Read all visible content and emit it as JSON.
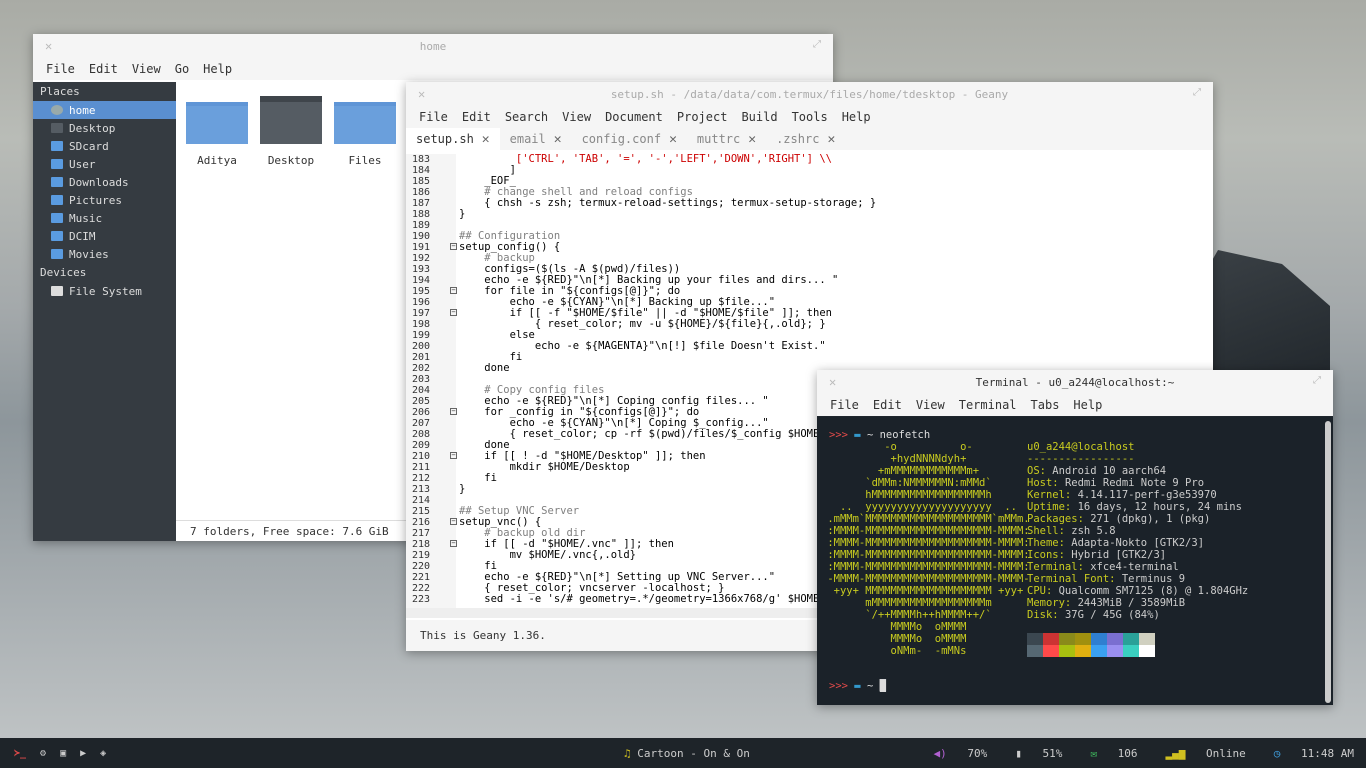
{
  "filemanager": {
    "title": "home",
    "menu": [
      "File",
      "Edit",
      "View",
      "Go",
      "Help"
    ],
    "places_header": "Places",
    "places": [
      "home",
      "Desktop",
      "SDcard",
      "User",
      "Downloads",
      "Pictures",
      "Music",
      "DCIM",
      "Movies"
    ],
    "devices_header": "Devices",
    "devices": [
      "File System"
    ],
    "folders": [
      "Aditya",
      "Desktop",
      "Files"
    ],
    "status": "7 folders, Free space: 7.6 GiB"
  },
  "geany": {
    "title": "setup.sh - /data/data/com.termux/files/home/tdesktop - Geany",
    "menu": [
      "File",
      "Edit",
      "Search",
      "View",
      "Document",
      "Project",
      "Build",
      "Tools",
      "Help"
    ],
    "tabs": [
      "setup.sh",
      "email",
      "config.conf",
      "muttrc",
      ".zshrc"
    ],
    "status": "This is Geany 1.36.",
    "lines": [
      {
        "n": "183",
        "t": "         ['CTRL', 'TAB', '=', '-','LEFT','DOWN','RIGHT'] \\\\"
      },
      {
        "n": "184",
        "t": "        ]"
      },
      {
        "n": "185",
        "t": "    _EOF_"
      },
      {
        "n": "186",
        "t": "    # change shell and reload configs"
      },
      {
        "n": "187",
        "t": "    { chsh -s zsh; termux-reload-settings; termux-setup-storage; }"
      },
      {
        "n": "188",
        "t": "}"
      },
      {
        "n": "189",
        "t": ""
      },
      {
        "n": "190",
        "t": "## Configuration"
      },
      {
        "n": "191",
        "t": "setup_config() {"
      },
      {
        "n": "192",
        "t": "    # backup"
      },
      {
        "n": "193",
        "t": "    configs=($(ls -A $(pwd)/files))"
      },
      {
        "n": "194",
        "t": "    echo -e ${RED}\"\\n[*] Backing up your files and dirs... \""
      },
      {
        "n": "195",
        "t": "    for file in \"${configs[@]}\"; do"
      },
      {
        "n": "196",
        "t": "        echo -e ${CYAN}\"\\n[*] Backing up $file...\""
      },
      {
        "n": "197",
        "t": "        if [[ -f \"$HOME/$file\" || -d \"$HOME/$file\" ]]; then"
      },
      {
        "n": "198",
        "t": "            { reset_color; mv -u ${HOME}/${file}{,.old}; }"
      },
      {
        "n": "199",
        "t": "        else"
      },
      {
        "n": "200",
        "t": "            echo -e ${MAGENTA}\"\\n[!] $file Doesn't Exist.\""
      },
      {
        "n": "201",
        "t": "        fi"
      },
      {
        "n": "202",
        "t": "    done"
      },
      {
        "n": "203",
        "t": ""
      },
      {
        "n": "204",
        "t": "    # Copy config files"
      },
      {
        "n": "205",
        "t": "    echo -e ${RED}\"\\n[*] Coping config files... \""
      },
      {
        "n": "206",
        "t": "    for _config in \"${configs[@]}\"; do"
      },
      {
        "n": "207",
        "t": "        echo -e ${CYAN}\"\\n[*] Coping $_config...\""
      },
      {
        "n": "208",
        "t": "        { reset_color; cp -rf $(pwd)/files/$_config $HOME; }"
      },
      {
        "n": "209",
        "t": "    done"
      },
      {
        "n": "210",
        "t": "    if [[ ! -d \"$HOME/Desktop\" ]]; then"
      },
      {
        "n": "211",
        "t": "        mkdir $HOME/Desktop"
      },
      {
        "n": "212",
        "t": "    fi"
      },
      {
        "n": "213",
        "t": "}"
      },
      {
        "n": "214",
        "t": ""
      },
      {
        "n": "215",
        "t": "## Setup VNC Server"
      },
      {
        "n": "216",
        "t": "setup_vnc() {"
      },
      {
        "n": "217",
        "t": "    # backup old dir"
      },
      {
        "n": "218",
        "t": "    if [[ -d \"$HOME/.vnc\" ]]; then"
      },
      {
        "n": "219",
        "t": "        mv $HOME/.vnc{,.old}"
      },
      {
        "n": "220",
        "t": "    fi"
      },
      {
        "n": "221",
        "t": "    echo -e ${RED}\"\\n[*] Setting up VNC Server...\""
      },
      {
        "n": "222",
        "t": "    { reset_color; vncserver -localhost; }"
      },
      {
        "n": "223",
        "t": "    sed -i -e 's/# geometry=.*/geometry=1366x768/g' $HOME/.vnc"
      }
    ]
  },
  "terminal": {
    "title": "Terminal - u0_a244@localhost:~",
    "menu": [
      "File",
      "Edit",
      "View",
      "Terminal",
      "Tabs",
      "Help"
    ],
    "prompt": ">>> ",
    "cmd": "~ neofetch",
    "prompt2": ">>> ",
    "cwd2": "~ ",
    "logo": [
      "          -o          o-",
      "           +hydNNNNdyh+",
      "         +mMMMMMMMMMMMMm+",
      "       `dMMm:NMMMMMMN:mMMd`",
      "       hMMMMMMMMMMMMMMMMMMh",
      "   ..  yyyyyyyyyyyyyyyyyyyy  ..",
      " .mMMm`MMMMMMMMMMMMMMMMMMMM`mMMm.",
      " :MMMM-MMMMMMMMMMMMMMMMMMMM-MMMM:",
      " :MMMM-MMMMMMMMMMMMMMMMMMMM-MMMM:",
      " :MMMM-MMMMMMMMMMMMMMMMMMMM-MMMM:",
      " :MMMM-MMMMMMMMMMMMMMMMMMMM-MMMM:",
      " -MMMM-MMMMMMMMMMMMMMMMMMMM-MMMM-",
      "  +yy+ MMMMMMMMMMMMMMMMMMMM +yy+",
      "       mMMMMMMMMMMMMMMMMMMm",
      "       `/++MMMMh++hMMMM++/`",
      "           MMMMo  oMMMM",
      "           MMMMo  oMMMM",
      "           oNMm-  -mMNs"
    ],
    "user_host": "u0_a244@localhost",
    "divider": "-----------------",
    "info": [
      {
        "k": "OS",
        "v": "Android 10 aarch64"
      },
      {
        "k": "Host",
        "v": "Redmi Redmi Note 9 Pro"
      },
      {
        "k": "Kernel",
        "v": "4.14.117-perf-g3e53970"
      },
      {
        "k": "Uptime",
        "v": "16 days, 12 hours, 24 mins"
      },
      {
        "k": "Packages",
        "v": "271 (dpkg), 1 (pkg)"
      },
      {
        "k": "Shell",
        "v": "zsh 5.8"
      },
      {
        "k": "Theme",
        "v": "Adapta-Nokto [GTK2/3]"
      },
      {
        "k": "Icons",
        "v": "Hybrid [GTK2/3]"
      },
      {
        "k": "Terminal",
        "v": "xfce4-terminal"
      },
      {
        "k": "Terminal Font",
        "v": "Terminus 9"
      },
      {
        "k": "CPU",
        "v": "Qualcomm SM7125 (8) @ 1.804GHz"
      },
      {
        "k": "Memory",
        "v": "2443MiB / 3589MiB"
      },
      {
        "k": "Disk",
        "v": "37G / 45G (84%)"
      }
    ],
    "colors_row1": [
      "#3b4750",
      "#cc3333",
      "#8a8a1a",
      "#a0900f",
      "#2f7fd0",
      "#7a6fd0",
      "#2aa198",
      "#d0d0c0"
    ],
    "colors_row2": [
      "#566873",
      "#ff4a4a",
      "#a8c010",
      "#e0b010",
      "#3aa0f0",
      "#9a8ff0",
      "#3ad0c0",
      "#ffffff"
    ]
  },
  "taskbar": {
    "now_playing": "Cartoon - On & On",
    "volume": "70%",
    "battery": "51%",
    "mail": "106",
    "network": "Online",
    "clock": "11:48 AM"
  }
}
